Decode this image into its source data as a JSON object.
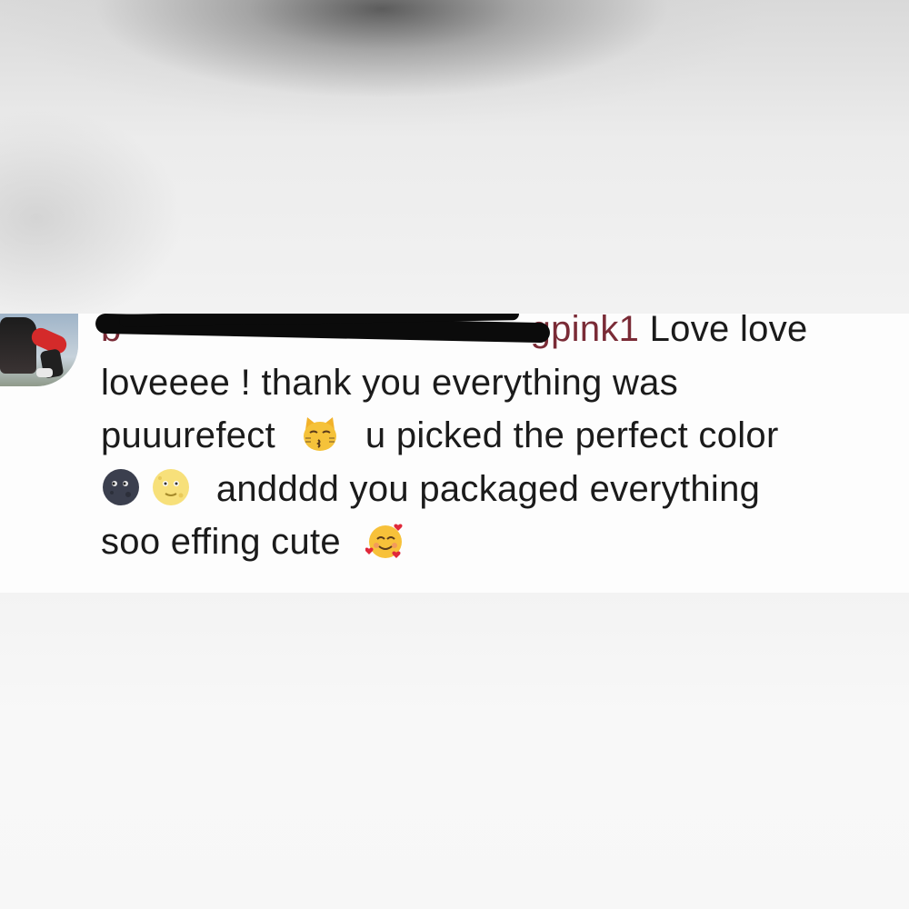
{
  "comment": {
    "username_visible_fragment": "b",
    "username_tail": "gpink1",
    "line1_text": "Love love",
    "line2_text": "loveeee ! thank you everything was",
    "line3_text_a": "puuurefect",
    "line3_text_b": "u picked the perfect color",
    "line4_text": "andddd you packaged everything",
    "line5_text": "soo effing cute",
    "emojis": [
      "kissing-cat-emoji",
      "new-moon-face-emoji",
      "full-moon-face-emoji",
      "smiling-face-with-hearts-emoji"
    ]
  },
  "colors": {
    "username": "#7a2b36",
    "text": "#1b1b1b",
    "strip_background": "#fdfdfd"
  }
}
